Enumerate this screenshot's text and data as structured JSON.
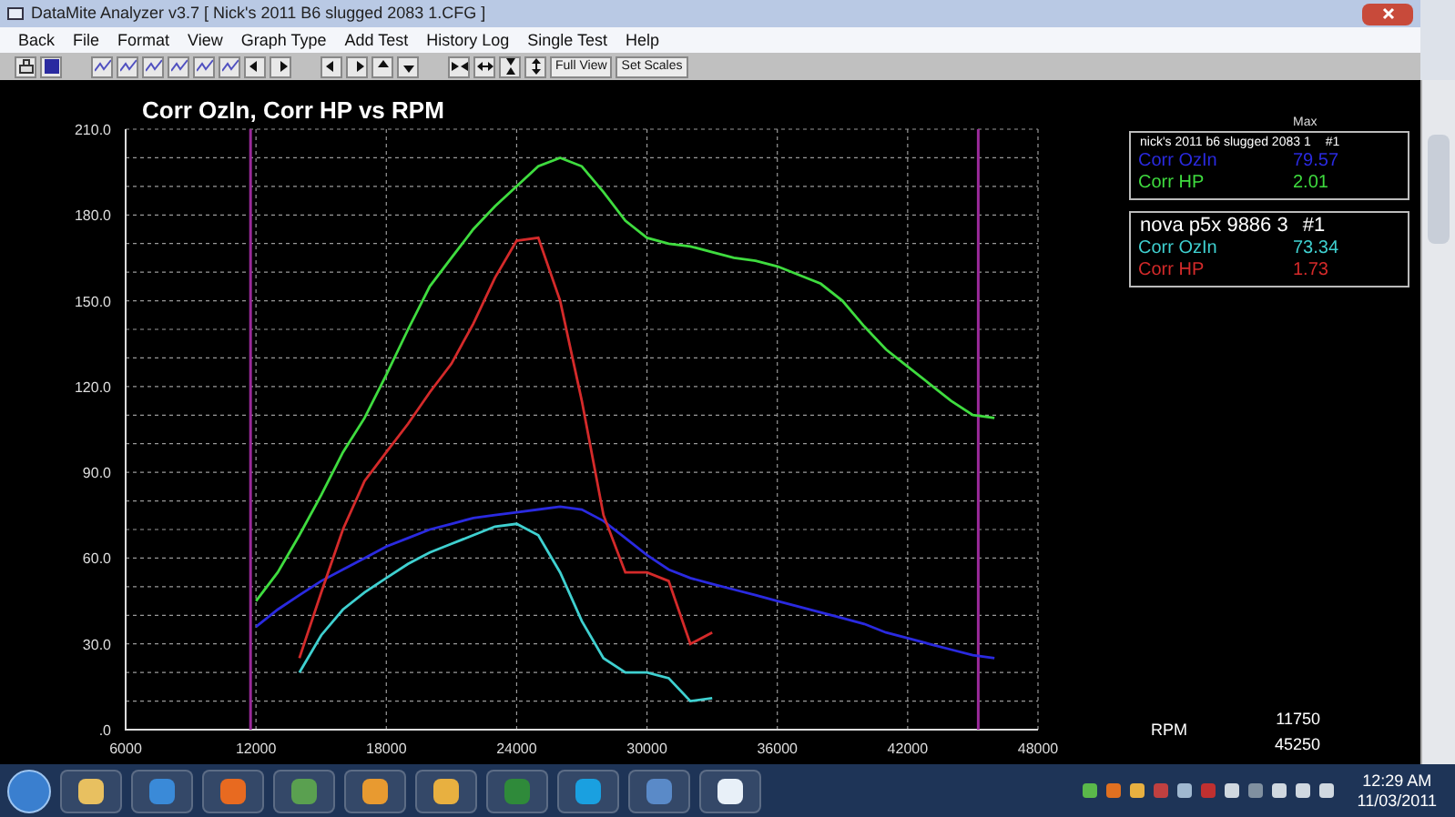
{
  "window": {
    "title": "DataMite Analyzer v3.7  [ Nick's 2011 B6  slugged 2083 1.CFG ]"
  },
  "menu": [
    "Back",
    "File",
    "Format",
    "View",
    "Graph Type",
    "Add Test",
    "History Log",
    "Single Test",
    "Help"
  ],
  "toolbar": {
    "text_buttons": [
      "Full View",
      "Set Scales"
    ]
  },
  "chart": {
    "chart_data": {
      "type": "line",
      "title": "Corr OzIn, Corr HP vs RPM",
      "xlim": [
        6000,
        48000
      ],
      "ylim": [
        0,
        210
      ],
      "xticks": [
        6000,
        12000,
        18000,
        24000,
        30000,
        36000,
        42000,
        48000
      ],
      "yticks": [
        {
          "value": 0,
          "label": ".0"
        },
        {
          "value": 30,
          "label": "30.0"
        },
        {
          "value": 60,
          "label": "60.0"
        },
        {
          "value": 90,
          "label": "90.0"
        },
        {
          "value": 120,
          "label": "120.0"
        },
        {
          "value": 150,
          "label": "150.0"
        },
        {
          "value": 180,
          "label": "180.0"
        },
        {
          "value": 210,
          "label": "210.0"
        }
      ],
      "x": [
        12000,
        13000,
        14000,
        15000,
        16000,
        17000,
        18000,
        19000,
        20000,
        21000,
        22000,
        23000,
        24000,
        25000,
        26000,
        27000,
        28000,
        29000,
        30000,
        31000,
        32000,
        33000,
        34000,
        35000,
        36000,
        37000,
        38000,
        39000,
        40000,
        41000,
        42000,
        43000,
        44000,
        45000,
        46000
      ],
      "series": [
        {
          "color": "#3fdc3f",
          "values": [
            45,
            55,
            68,
            82,
            97,
            109,
            124,
            140,
            155,
            165,
            175,
            183,
            190,
            197,
            200,
            197,
            188,
            178,
            172,
            170,
            169,
            167,
            165,
            164,
            162,
            159,
            156,
            150,
            141,
            133,
            127,
            121,
            115,
            110,
            109
          ]
        },
        {
          "color": "#2a2ae0",
          "values": [
            36,
            42,
            47,
            52,
            56,
            60,
            64,
            67,
            70,
            72,
            74,
            75,
            76,
            77,
            78,
            77,
            73,
            67,
            61,
            56,
            53,
            51,
            49,
            47,
            45,
            43,
            41,
            39,
            37,
            34,
            32,
            30,
            28,
            26,
            25
          ]
        },
        {
          "color": "#d42a2a",
          "values": [
            null,
            null,
            25,
            48,
            70,
            87,
            97,
            107,
            118,
            128,
            142,
            158,
            171,
            172,
            150,
            115,
            75,
            55,
            55,
            52,
            30,
            34,
            null,
            null,
            null,
            null,
            null,
            null,
            null,
            null,
            null,
            null,
            null,
            null,
            null
          ]
        },
        {
          "color": "#3fd0d0",
          "values": [
            null,
            null,
            20,
            33,
            42,
            48,
            53,
            58,
            62,
            65,
            68,
            71,
            72,
            68,
            55,
            38,
            25,
            20,
            20,
            18,
            10,
            11,
            null,
            null,
            null,
            null,
            null,
            null,
            null,
            null,
            null,
            null,
            null,
            null,
            null
          ]
        }
      ],
      "grid": true,
      "ref_lines": [
        {
          "axis": "x",
          "value": 11750,
          "color": "#9a2a9a"
        },
        {
          "axis": "x",
          "value": 45250,
          "color": "#9a2a9a"
        }
      ]
    },
    "xaxis_label": "RPM",
    "cursor_readouts": [
      "11750",
      "45250"
    ]
  },
  "legend": [
    {
      "title": "nick's 2011 b6  slugged 2083 1",
      "run": "#1",
      "column_header": "Max",
      "rows": [
        {
          "label": "Corr OzIn",
          "value": "79.57",
          "color": "#2a2ae0"
        },
        {
          "label": "Corr HP",
          "value": "2.01",
          "color": "#3fdc3f"
        }
      ]
    },
    {
      "title": "nova p5x 9886 3",
      "run": "#1",
      "rows": [
        {
          "label": "Corr OzIn",
          "value": "73.34",
          "color": "#3fd0d0"
        },
        {
          "label": "Corr HP",
          "value": "1.73",
          "color": "#d42a2a"
        }
      ]
    }
  ],
  "taskbar": {
    "time": "12:29 AM",
    "date": "11/03/2011"
  }
}
